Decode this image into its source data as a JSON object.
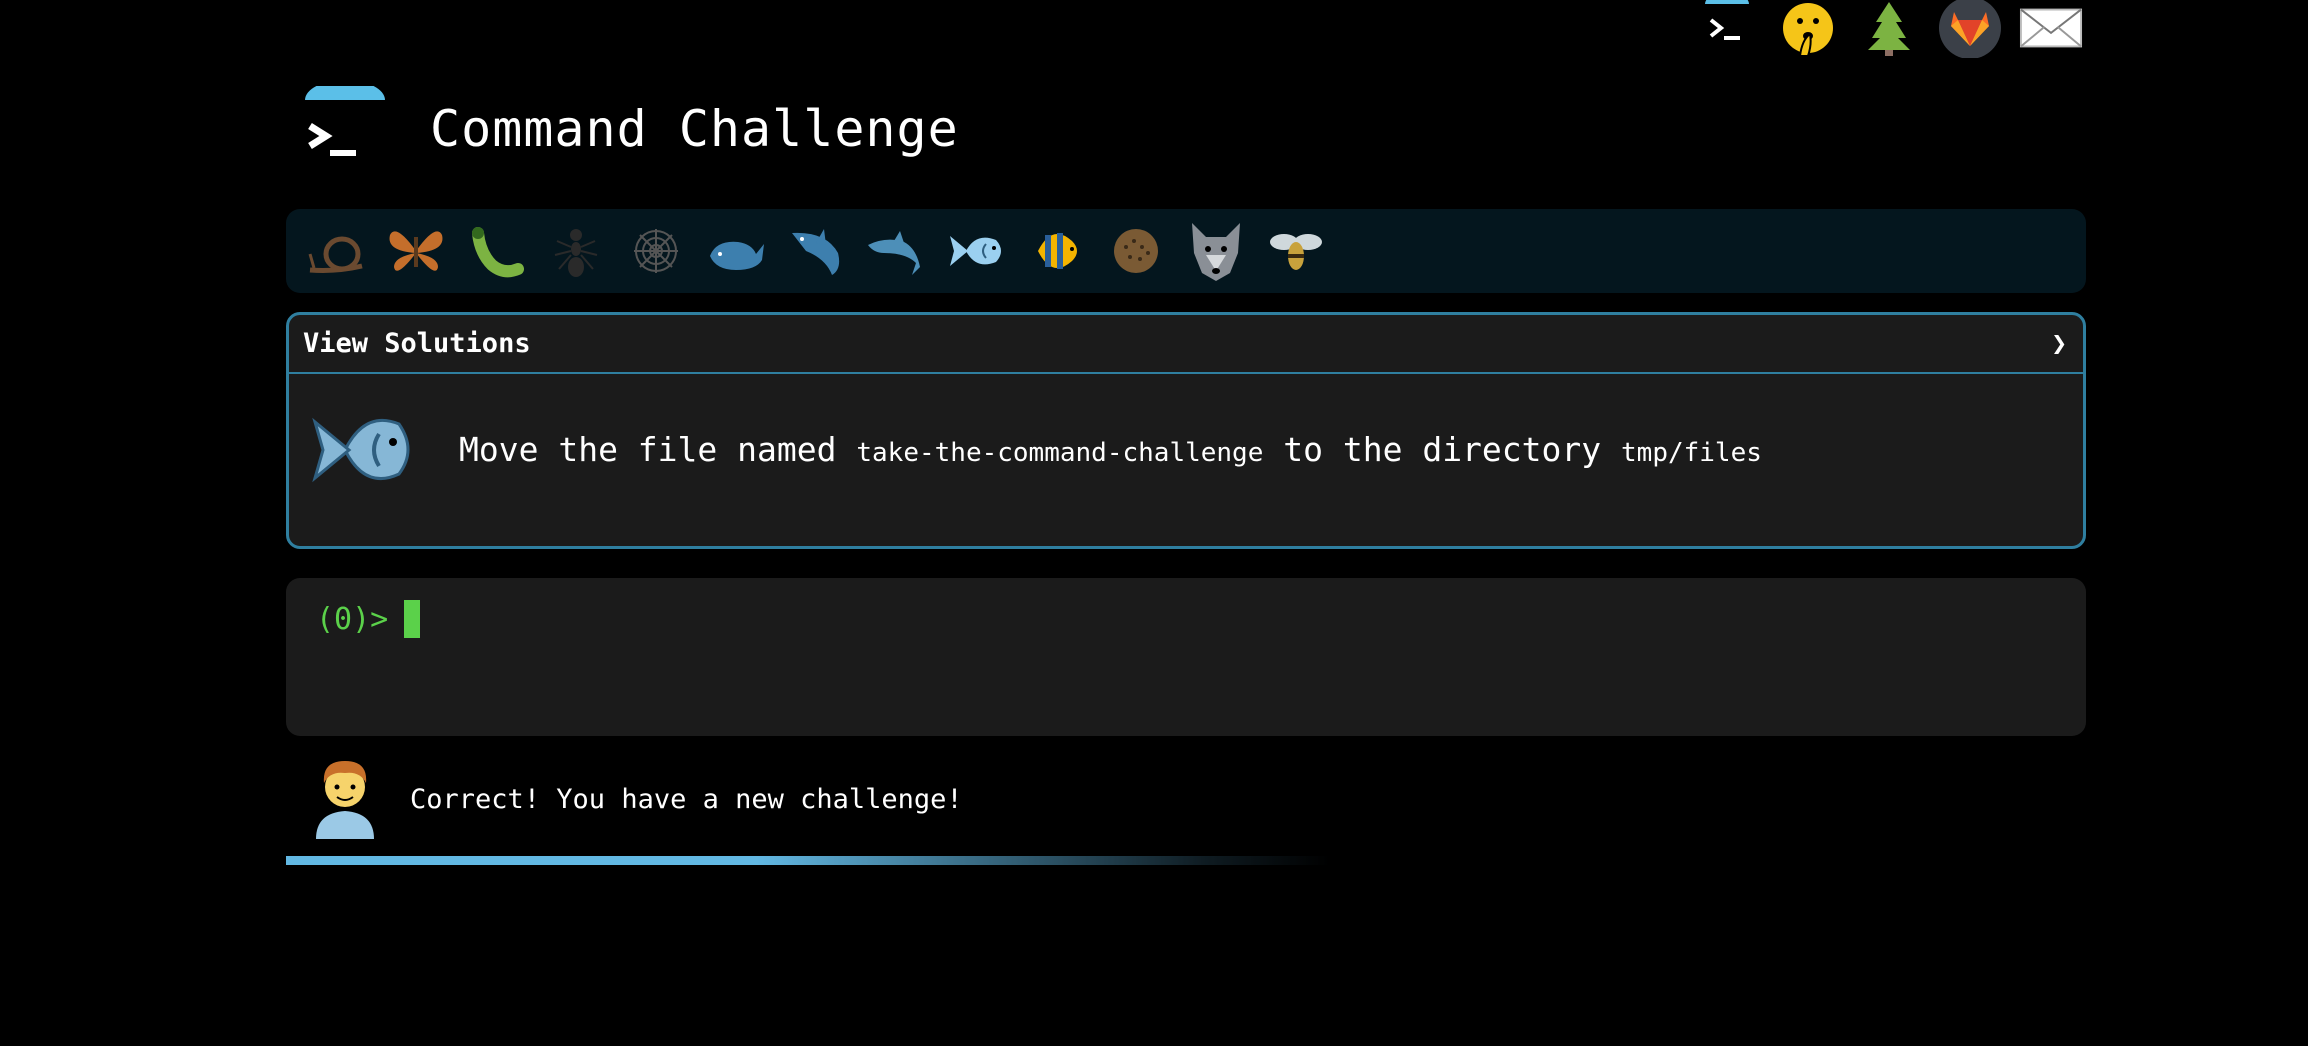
{
  "app": {
    "title": "Command Challenge"
  },
  "top_icons": [
    {
      "name": "terminal-icon"
    },
    {
      "name": "shushing-face-icon"
    },
    {
      "name": "tree-icon"
    },
    {
      "name": "gitlab-icon"
    },
    {
      "name": "mail-icon"
    }
  ],
  "levels": [
    "snail-icon",
    "butterfly-icon",
    "caterpillar-icon",
    "ant-icon",
    "spider-web-icon",
    "whale-icon",
    "shark-icon",
    "dolphin-icon",
    "fish-icon",
    "tropical-fish-icon",
    "blowfish-icon",
    "wolf-icon",
    "bee-icon"
  ],
  "current_level_index": 8,
  "panel": {
    "header": "View Solutions",
    "chevron": "❯",
    "task_prefix": "Move the file named",
    "task_file": "take-the-command-challenge",
    "task_middle": "to the directory",
    "task_dir": "tmp/files"
  },
  "terminal": {
    "prompt": "(0)>"
  },
  "status": {
    "message": "Correct! You have a new challenge!"
  },
  "progress": {
    "fraction": 0.58
  },
  "colors": {
    "accent": "#62b8e3",
    "prompt": "#5bd14a",
    "panel_border": "#2f7fa0"
  }
}
